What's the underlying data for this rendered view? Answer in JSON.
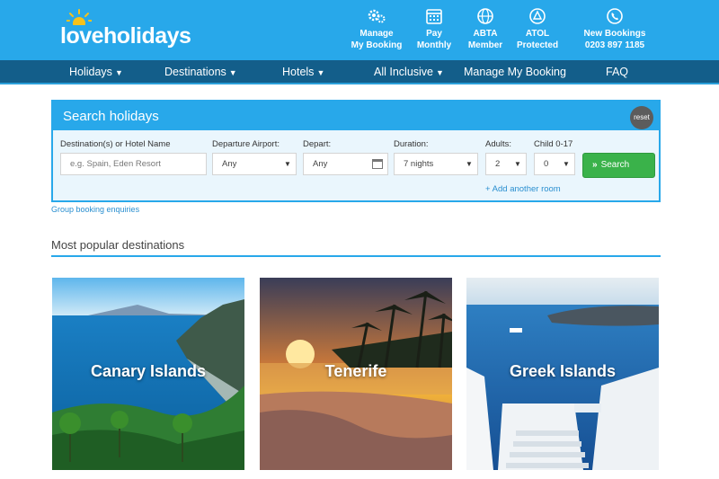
{
  "brand": {
    "logo_text": "loveholidays"
  },
  "top_links": [
    {
      "line1": "Manage",
      "line2": "My Booking",
      "icon": "gears-icon"
    },
    {
      "line1": "Pay",
      "line2": "Monthly",
      "icon": "calendar-icon"
    },
    {
      "line1": "ABTA",
      "line2": "Member",
      "icon": "globe-icon"
    },
    {
      "line1": "ATOL",
      "line2": "Protected",
      "icon": "badge-icon"
    },
    {
      "line1": "New Bookings",
      "line2": "0203 897 1185",
      "icon": "phone-icon"
    }
  ],
  "nav": [
    {
      "label": "Holidays",
      "has_dropdown": true
    },
    {
      "label": "Destinations",
      "has_dropdown": true
    },
    {
      "label": "Hotels",
      "has_dropdown": true
    },
    {
      "label": "All Inclusive",
      "has_dropdown": true
    },
    {
      "label": "Manage My Booking",
      "has_dropdown": false
    },
    {
      "label": "FAQ",
      "has_dropdown": false
    }
  ],
  "search": {
    "title": "Search holidays",
    "reset_label": "reset",
    "destination": {
      "label": "Destination(s) or Hotel Name",
      "placeholder": "e.g. Spain, Eden Resort"
    },
    "departure_airport": {
      "label": "Departure Airport:",
      "value": "Any"
    },
    "depart": {
      "label": "Depart:",
      "value": "Any"
    },
    "duration": {
      "label": "Duration:",
      "value": "7 nights"
    },
    "adults": {
      "label": "Adults:",
      "value": "2"
    },
    "children": {
      "label": "Child 0-17",
      "value": "0"
    },
    "search_button": "Search",
    "add_room": "+ Add another room"
  },
  "group_booking": "Group booking enquiries",
  "popular": {
    "title": "Most popular destinations",
    "cards": [
      {
        "label": "Canary Islands"
      },
      {
        "label": "Tenerife"
      },
      {
        "label": "Greek Islands"
      }
    ]
  },
  "colors": {
    "brand_blue": "#28a8ea",
    "nav_dark": "#135e8a",
    "search_green": "#3ab24a",
    "link_blue": "#2a8fd0"
  }
}
